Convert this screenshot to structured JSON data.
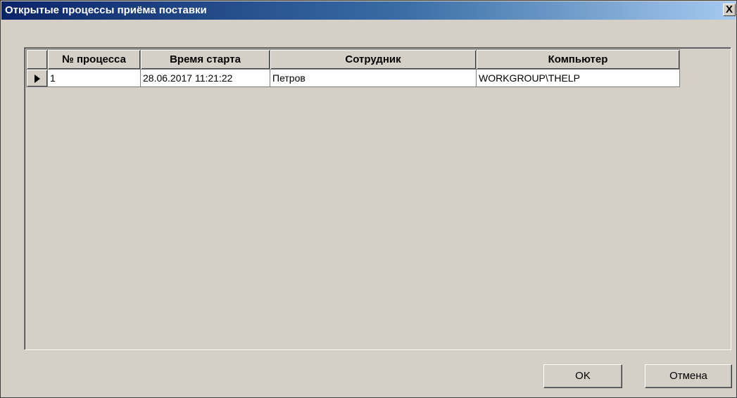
{
  "window": {
    "title": "Открытые процессы приёма поставки",
    "close_glyph": "X"
  },
  "grid": {
    "columns": [
      "№ процесса",
      "Время старта",
      "Сотрудник",
      "Компьютер"
    ],
    "rows": [
      {
        "current": true,
        "process_no": "1",
        "start_time": "28.06.2017 11:21:22",
        "employee": "Петров",
        "computer": "WORKGROUP\\THELP"
      }
    ]
  },
  "buttons": {
    "ok": "OK",
    "cancel": "Отмена"
  }
}
